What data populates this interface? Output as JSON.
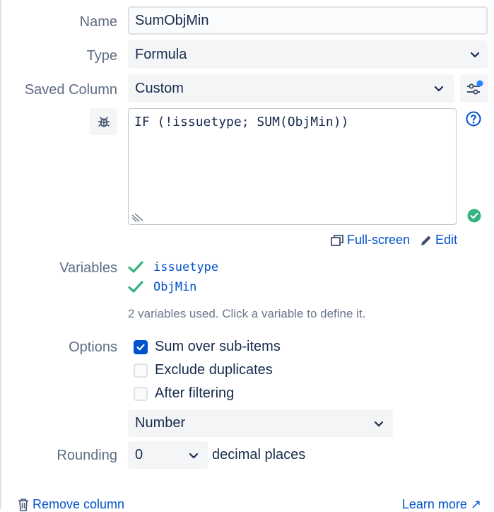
{
  "name": {
    "label": "Name",
    "value": "SumObjMin"
  },
  "type": {
    "label": "Type",
    "selected": "Formula"
  },
  "saved_column": {
    "label": "Saved Column",
    "selected": "Custom"
  },
  "formula": {
    "text": "IF (!issuetype; SUM(ObjMin))"
  },
  "links": {
    "full_screen": "Full-screen",
    "edit": "Edit"
  },
  "variables": {
    "label": "Variables",
    "items": [
      {
        "name": "issuetype"
      },
      {
        "name": "ObjMin"
      }
    ],
    "hint": "2 variables used. Click a variable to define it."
  },
  "options": {
    "label": "Options",
    "items": [
      {
        "label": "Sum over sub-items",
        "checked": true
      },
      {
        "label": "Exclude duplicates",
        "checked": false
      },
      {
        "label": "After filtering",
        "checked": false
      }
    ],
    "format_selected": "Number"
  },
  "rounding": {
    "label": "Rounding",
    "selected": "0",
    "suffix": "decimal places"
  },
  "footer": {
    "remove": "Remove column",
    "learn_more": "Learn more ↗"
  },
  "colors": {
    "accent": "#0052cc",
    "success": "#36b37e",
    "label": "#5e6c84"
  }
}
